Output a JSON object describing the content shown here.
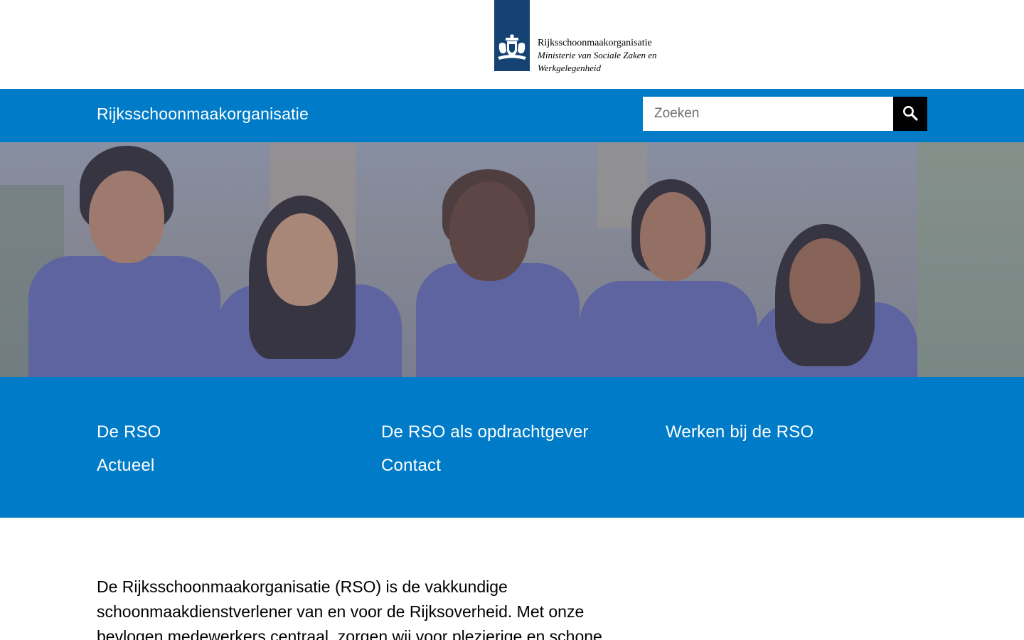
{
  "logo": {
    "organisation": "Rijksschoonmaakorganisatie",
    "ministry": "Ministerie van Sociale Zaken en Werkgelegenheid",
    "bar_color": "#154273",
    "emblem_icon": "crest-icon"
  },
  "site_bar": {
    "title": "Rijksschoonmaakorganisatie",
    "background": "#007bc7"
  },
  "search": {
    "placeholder": "Zoeken",
    "value": "",
    "button_icon": "search-icon"
  },
  "hero": {
    "image_subject": "five-cleaning-staff-photo"
  },
  "menu": {
    "items": [
      {
        "label": "De RSO"
      },
      {
        "label": "De RSO als opdrachtgever"
      },
      {
        "label": "Werken bij de RSO"
      },
      {
        "label": "Actueel"
      },
      {
        "label": "Contact"
      }
    ]
  },
  "intro": {
    "text": "De Rijksschoonmaakorganisatie (RSO) is de vakkundige schoonmaakdienstverlener van en voor de Rijksoverheid. Met onze bevlogen medewerkers centraal, zorgen wij voor plezierige en schone"
  }
}
